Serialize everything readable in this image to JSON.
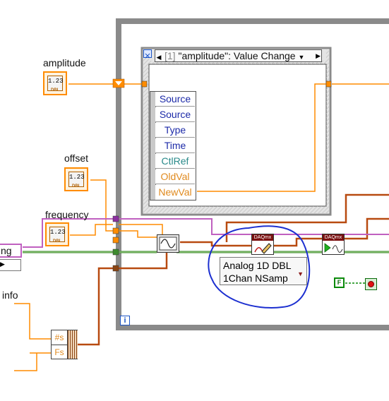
{
  "controls": {
    "amplitude_label": "amplitude",
    "offset_label": "offset",
    "frequency_label": "frequency",
    "numeric_text": "1.23",
    "numeric_type": "DBL"
  },
  "event_structure": {
    "case_index": "[1]",
    "case_name": "\"amplitude\": Value Change",
    "data_nodes": [
      "Source",
      "Source",
      "Type",
      "Time",
      "CtlRef",
      "OldVal",
      "NewVal"
    ]
  },
  "daqmx": {
    "write_tag": "DAQmx",
    "start_tag": "DAQmx",
    "polymorphic_line1": "Analog 1D DBL",
    "polymorphic_line2": "1Chan NSamp"
  },
  "loop": {
    "iteration_terminal": "i",
    "stop_constant": "F"
  },
  "left_fragments": {
    "string_cut": "ng",
    "info_label": "info",
    "bundle_row1": "#s",
    "bundle_row2": "Fs"
  },
  "colors": {
    "numeric_orange": "#ff8c00",
    "loop_border": "#8a8a8a",
    "boolean_green": "#0a8a0a",
    "string_pink": "#c060c0",
    "cluster_brown": "#8b4513",
    "annotation_blue": "#1c2fd0"
  }
}
